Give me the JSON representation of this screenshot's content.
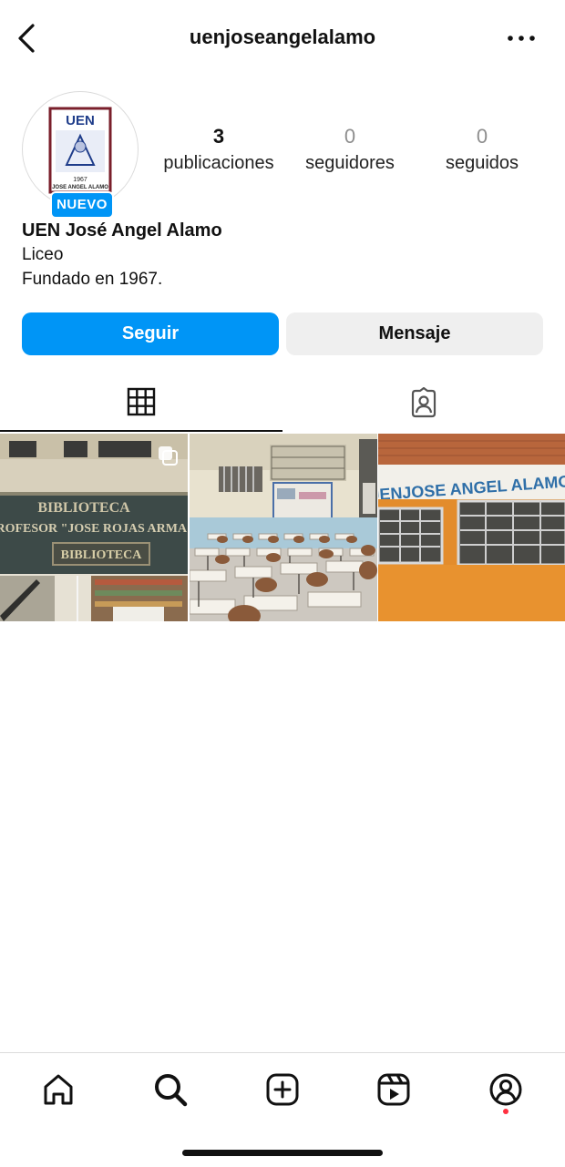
{
  "header": {
    "username": "uenjoseangelalamo",
    "back_icon": "chevron-left-icon",
    "more_icon": "more-horizontal-icon"
  },
  "profile": {
    "avatar_logo_text": "UEN",
    "avatar_logo_year": "1967",
    "avatar_logo_motto": "JOSE ANGEL ALAMO",
    "new_badge": "NUEVO",
    "stats": [
      {
        "value": "3",
        "label": "publicaciones"
      },
      {
        "value": "0",
        "label": "seguidores"
      },
      {
        "value": "0",
        "label": "seguidos"
      }
    ],
    "name": "UEN José Angel Alamo",
    "category": "Liceo",
    "bio": "Fundado en 1967."
  },
  "actions": {
    "follow_label": "Seguir",
    "message_label": "Mensaje"
  },
  "tabs": [
    {
      "icon": "grid-icon",
      "active": true
    },
    {
      "icon": "tagged-user-icon",
      "active": false
    }
  ],
  "posts": [
    {
      "sign_text_1": "BIBLIOTECA",
      "sign_text_2": "PROFESOR \"JOSE ROJAS ARMA",
      "sign_text_3": "BIBLIOTECA",
      "multi": true
    },
    {
      "multi": false
    },
    {
      "wall_text": "UENJOSE ANGEL ALAMO",
      "multi": false
    }
  ],
  "bottom_nav": [
    {
      "icon": "home-icon"
    },
    {
      "icon": "search-icon"
    },
    {
      "icon": "create-post-icon"
    },
    {
      "icon": "reels-icon"
    },
    {
      "icon": "profile-icon"
    }
  ],
  "colors": {
    "primary": "#0095f6",
    "secondary_button": "#efefef",
    "notification": "#ff3040"
  }
}
